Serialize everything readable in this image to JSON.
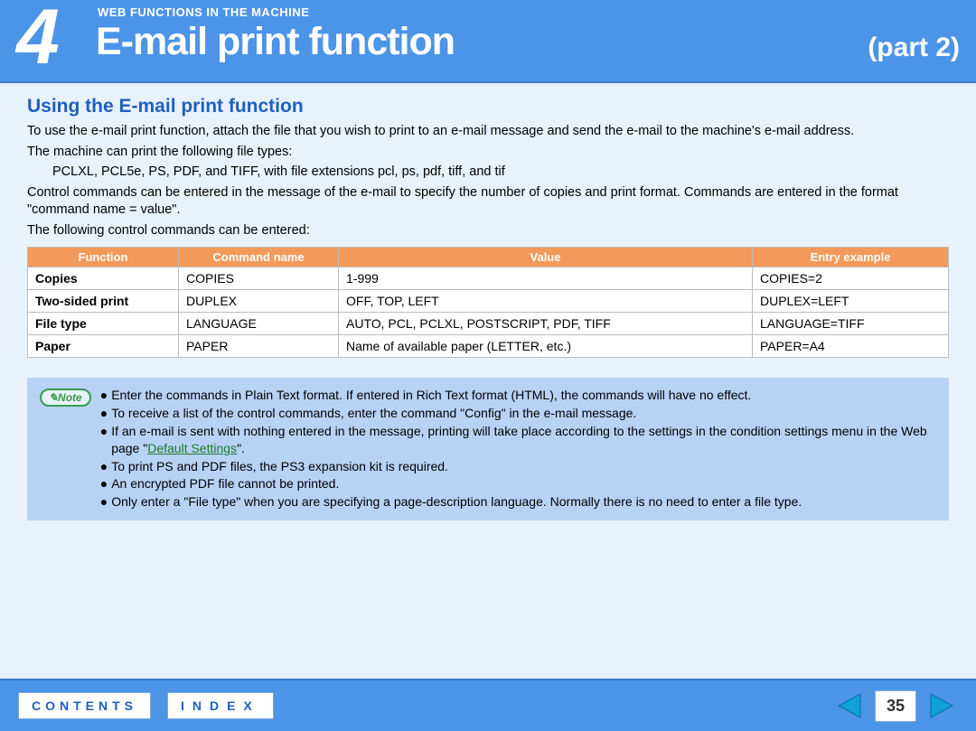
{
  "header": {
    "chapter_number": "4",
    "chapter_label": "WEB FUNCTIONS IN THE MACHINE",
    "title": "E-mail print function",
    "part": "(part 2)"
  },
  "section_title": "Using the E-mail print function",
  "paragraphs": {
    "p1": "To use the e-mail print function, attach the file that you wish to print to an e-mail message and send the e-mail to the machine's e-mail address.",
    "p2": "The machine can print the following file types:",
    "p3": "PCLXL, PCL5e, PS, PDF, and TIFF, with file extensions pcl, ps, pdf, tiff, and tif",
    "p4": "Control commands can be entered in the message of the e-mail to specify the number of copies and print format. Commands are entered in the format \"command name = value\".",
    "p5": "The following control commands can be entered:"
  },
  "table": {
    "headers": {
      "h0": "Function",
      "h1": "Command name",
      "h2": "Value",
      "h3": "Entry example"
    },
    "rows": [
      {
        "fn": "Copies",
        "cn": "COPIES",
        "val": "1-999",
        "ex": "COPIES=2"
      },
      {
        "fn": "Two-sided print",
        "cn": "DUPLEX",
        "val": "OFF, TOP, LEFT",
        "ex": "DUPLEX=LEFT"
      },
      {
        "fn": "File type",
        "cn": "LANGUAGE",
        "val": "AUTO, PCL, PCLXL, POSTSCRIPT, PDF, TIFF",
        "ex": "LANGUAGE=TIFF"
      },
      {
        "fn": "Paper",
        "cn": "PAPER",
        "val": "Name of available paper (LETTER, etc.)",
        "ex": "PAPER=A4"
      }
    ]
  },
  "note": {
    "label": "✎Note",
    "items": [
      "Enter the commands in Plain Text format. If entered in Rich Text format (HTML), the commands will have no effect.",
      "To receive a list of the control commands, enter the command \"Config\" in the e-mail message.",
      "If an e-mail is sent with nothing entered in the message, printing will take place according to the settings in the condition settings menu in the Web page \"",
      "To print PS and PDF files, the PS3 expansion kit is required.",
      "An encrypted PDF file cannot be printed.",
      "Only enter a \"File type\" when you are specifying a page-description language. Normally there is no need to enter a file type."
    ],
    "link_text": "Default Settings",
    "link_tail": "\"."
  },
  "footer": {
    "contents": "CONTENTS",
    "index": "INDEX",
    "page": "35"
  }
}
